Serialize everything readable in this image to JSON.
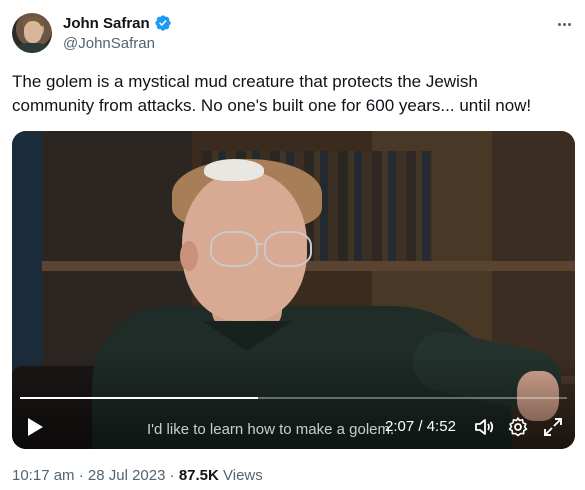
{
  "author": {
    "display_name": "John Safran",
    "handle": "@JohnSafran",
    "verified_icon": "verified-badge-icon",
    "verified_color": "#1d9bf0"
  },
  "tweet": {
    "text": "The golem is a mystical mud creature that protects the Jewish\ncommunity from attacks. No one's built one for 600 years... until now!"
  },
  "video": {
    "subtitle": "I'd like to learn how to make a golem.",
    "current_time": "2:07",
    "separator": "/",
    "duration": "4:52",
    "progress": 0.435,
    "icons": [
      "play-icon",
      "volume-icon",
      "settings-gear-icon",
      "fullscreen-icon"
    ]
  },
  "meta": {
    "time": "10:17 am",
    "dot": "·",
    "date": "28 Jul 2023",
    "dot2": "·",
    "views_count": "87.5K",
    "views_label": "Views"
  },
  "more_icon": "more-options-icon"
}
